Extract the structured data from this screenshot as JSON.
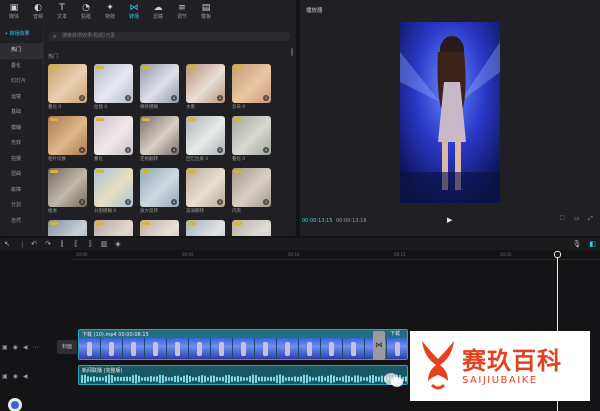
{
  "toolbar": {
    "tabs": [
      {
        "label": "媒体",
        "icon": "media-icon"
      },
      {
        "label": "音频",
        "icon": "audio-icon"
      },
      {
        "label": "文本",
        "icon": "text-icon"
      },
      {
        "label": "贴纸",
        "icon": "sticker-icon"
      },
      {
        "label": "特效",
        "icon": "effects-icon"
      },
      {
        "label": "转场",
        "icon": "transition-icon"
      },
      {
        "label": "滤镜",
        "icon": "filter-icon"
      },
      {
        "label": "调节",
        "icon": "adjust-icon"
      },
      {
        "label": "模板",
        "icon": "template-icon"
      }
    ],
    "active_index": 5
  },
  "subnav": {
    "header": "• 转场效果",
    "items": [
      "热门",
      "叠化",
      "幻灯片",
      "运镜",
      "基础",
      "模糊",
      "光效",
      "拍摄",
      "扭曲",
      "故障",
      "分割",
      "自然"
    ],
    "selected_index": 0
  },
  "search": {
    "placeholder": "搜索转场效果/贴纸/元素"
  },
  "section_title": "热门",
  "transitions": [
    {
      "label": "叠化 II",
      "colors": [
        "#c8a070",
        "#e8d0b0"
      ]
    },
    {
      "label": "拉镜 II",
      "colors": [
        "#b0b8c8",
        "#e8e8f0"
      ]
    },
    {
      "label": "横移模糊",
      "colors": [
        "#9098a8",
        "#e0e0e8"
      ]
    },
    {
      "label": "水墨",
      "colors": [
        "#b89078",
        "#e8e0d8"
      ]
    },
    {
      "label": "云朵 II",
      "colors": [
        "#c89878",
        "#e8c8a0"
      ]
    },
    {
      "label": "相片切换",
      "colors": [
        "#a87850",
        "#e0b888"
      ]
    },
    {
      "label": "叠化",
      "colors": [
        "#c8c0c8",
        "#f0e8e8"
      ]
    },
    {
      "label": "定格翻转",
      "colors": [
        "#787068",
        "#d8d0c8"
      ]
    },
    {
      "label": "回忆拉屏 II",
      "colors": [
        "#a8b0b8",
        "#e8ece8"
      ]
    },
    {
      "label": "叠化 II",
      "colors": [
        "#a0a8a0",
        "#d8d8d0"
      ]
    },
    {
      "label": "推进",
      "colors": [
        "#70685c",
        "#c0b8a8"
      ]
    },
    {
      "label": "分割模糊 II",
      "colors": [
        "#a8c0d8",
        "#e8e0c0"
      ]
    },
    {
      "label": "放大反转",
      "colors": [
        "#90a8b8",
        "#d0d8e0"
      ]
    },
    {
      "label": "漩涡翻转",
      "colors": [
        "#b8a898",
        "#e8e0d0"
      ]
    },
    {
      "label": "闪黑",
      "colors": [
        "#a09888",
        "#d8d0c8"
      ]
    },
    {
      "label": "",
      "colors": [
        "#8890a0",
        "#c8d0d8"
      ]
    },
    {
      "label": "",
      "colors": [
        "#b8a8a0",
        "#e0d8d0"
      ]
    },
    {
      "label": "",
      "colors": [
        "#c0b0a0",
        "#e8e0d8"
      ]
    },
    {
      "label": "",
      "colors": [
        "#a8b0b8",
        "#e0e4e8"
      ]
    },
    {
      "label": "",
      "colors": [
        "#b8b0a8",
        "#e0dcd8"
      ]
    }
  ],
  "player": {
    "title": "播放器",
    "current_time": "00:00:13:15",
    "total_time": "00:00:13:16",
    "play_icon": "play-icon"
  },
  "timeline": {
    "ruler_labels": [
      "00:00",
      "00:05",
      "00:10",
      "00:15",
      "00:20"
    ],
    "cover_label": "封面",
    "clip1_label": "下载 (10).mp4 00:00:08:15",
    "clip2_label": "下载",
    "audio_label": "新闻联播 (完整版)"
  },
  "watermark": {
    "cn": "赛玖百科",
    "en": "SAIJIUBAIKE"
  },
  "colors": {
    "accent": "#2fd0e8",
    "clip": "#1f6f7c",
    "brand": "#e6411e"
  }
}
